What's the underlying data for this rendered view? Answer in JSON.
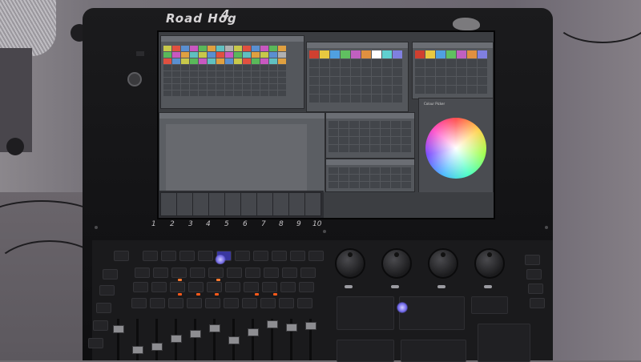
{
  "console": {
    "brand": "Road Hog",
    "brand_version": "4",
    "logo_icon": "boar-logo-icon",
    "colors": {
      "body": "#121214",
      "screen_bg": "#3b3d41",
      "led_orange": "#ff5a1a",
      "led_blue": "#7b72ff"
    }
  },
  "screen": {
    "windows": [
      "fixture-window",
      "palette-window",
      "palette-window-2",
      "colour-picker-window",
      "effects-window",
      "position-window"
    ],
    "colour_picker_title": "Colour Picker"
  },
  "fader_numbers": [
    "1",
    "2",
    "3",
    "4",
    "5",
    "6",
    "7",
    "8",
    "9",
    "10"
  ]
}
